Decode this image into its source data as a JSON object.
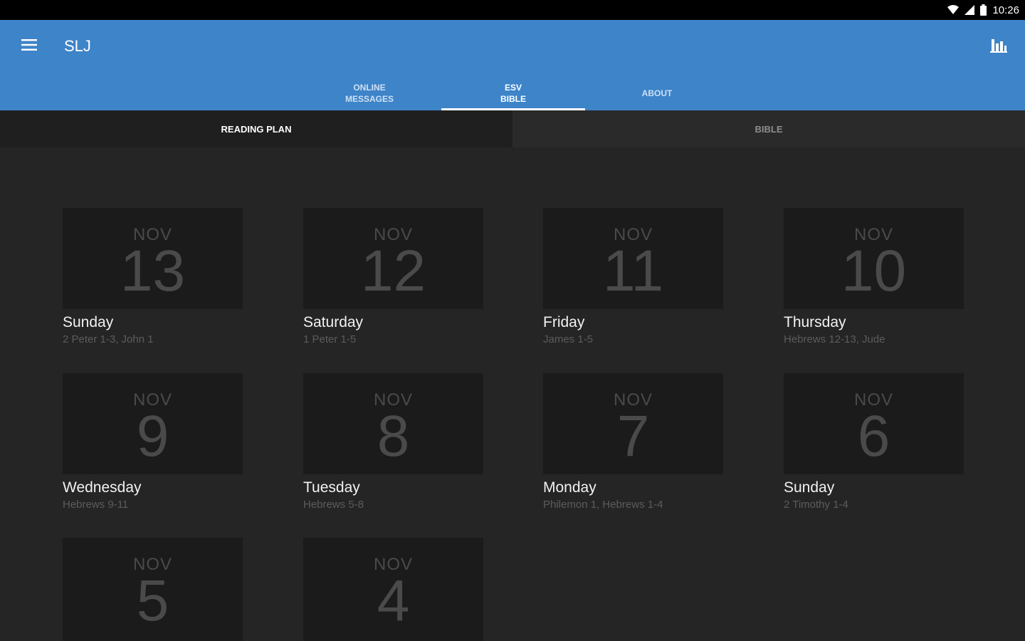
{
  "status_bar": {
    "time": "10:26",
    "icons": [
      "wifi-icon",
      "signal-icon",
      "battery-icon"
    ]
  },
  "app_bar": {
    "title": "SLJ",
    "menu_icon": "hamburger-menu-icon",
    "action_icon": "bar-chart-icon",
    "color": "#3d84c9"
  },
  "tabs": [
    {
      "label": "ONLINE\nMESSAGES",
      "active": false
    },
    {
      "label": "ESV\nBIBLE",
      "active": true
    },
    {
      "label": "ABOUT",
      "active": false
    }
  ],
  "subtabs": [
    {
      "label": "READING PLAN",
      "active": true
    },
    {
      "label": "BIBLE",
      "active": false
    }
  ],
  "days": [
    {
      "month": "NOV",
      "day": "13",
      "weekday": "Sunday",
      "reading": "2 Peter 1-3, John 1"
    },
    {
      "month": "NOV",
      "day": "12",
      "weekday": "Saturday",
      "reading": "1 Peter 1-5"
    },
    {
      "month": "NOV",
      "day": "11",
      "weekday": "Friday",
      "reading": "James 1-5"
    },
    {
      "month": "NOV",
      "day": "10",
      "weekday": "Thursday",
      "reading": "Hebrews 12-13, Jude"
    },
    {
      "month": "NOV",
      "day": "9",
      "weekday": "Wednesday",
      "reading": "Hebrews 9-11"
    },
    {
      "month": "NOV",
      "day": "8",
      "weekday": "Tuesday",
      "reading": "Hebrews 5-8"
    },
    {
      "month": "NOV",
      "day": "7",
      "weekday": "Monday",
      "reading": "Philemon 1, Hebrews 1-4"
    },
    {
      "month": "NOV",
      "day": "6",
      "weekday": "Sunday",
      "reading": "2 Timothy 1-4"
    },
    {
      "month": "NOV",
      "day": "5",
      "weekday": "",
      "reading": ""
    },
    {
      "month": "NOV",
      "day": "4",
      "weekday": "",
      "reading": ""
    }
  ]
}
